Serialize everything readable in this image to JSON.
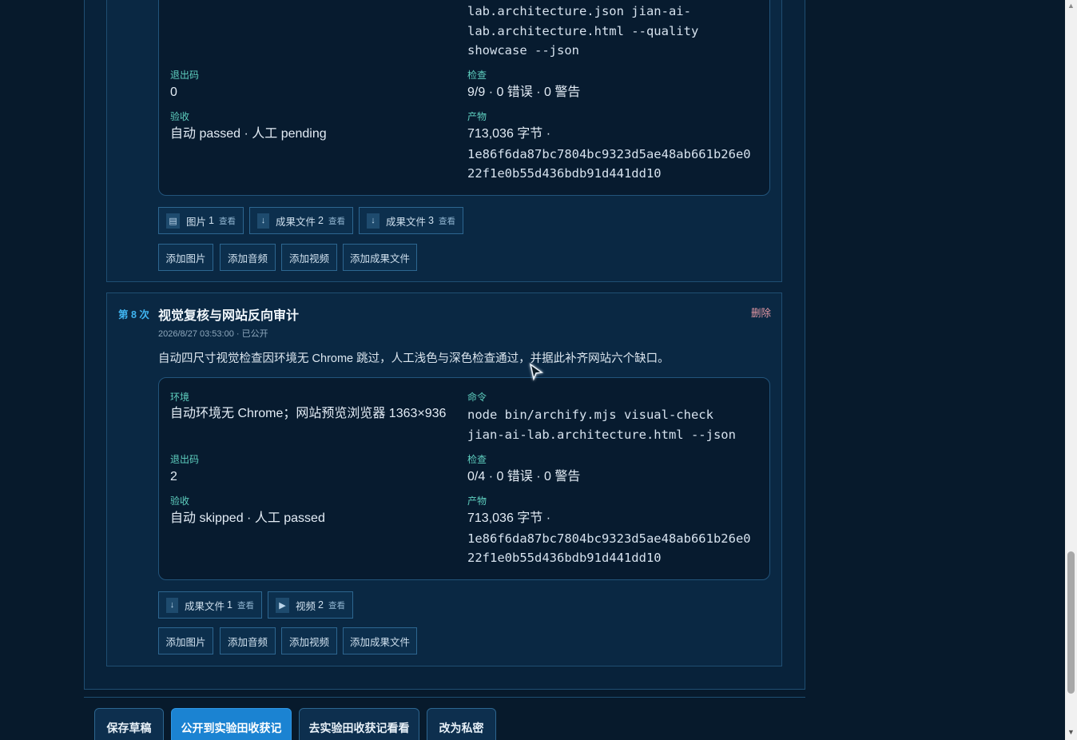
{
  "runs": [
    {
      "command_tail": [
        "lab.architecture.json jian-ai-",
        "lab.architecture.html --quality",
        "showcase --json"
      ],
      "fields": {
        "exit_label": "退出码",
        "exit_value": "0",
        "check_label": "检查",
        "check_value": "9/9 · 0 错误 · 0 警告",
        "acceptance_label": "验收",
        "acceptance_value": "自动 passed · 人工 pending",
        "artifact_label": "产物",
        "artifact_size": "713,036 字节 ·",
        "artifact_hash_1": "1e86f6da87bc7804bc9323d5ae48ab661b26e0",
        "artifact_hash_2": "22f1e0b55d436bdb91d441dd10"
      },
      "attachments": [
        {
          "icon": "image-icon",
          "glyph": "▤",
          "label": "图片",
          "count": "1",
          "view": "查看"
        },
        {
          "icon": "download-icon",
          "glyph": "↓",
          "label": "成果文件",
          "count": "2",
          "view": "查看"
        },
        {
          "icon": "download-icon",
          "glyph": "↓",
          "label": "成果文件",
          "count": "3",
          "view": "查看"
        }
      ],
      "add_buttons": [
        "添加图片",
        "添加音频",
        "添加视频",
        "添加成果文件"
      ]
    },
    {
      "number": "第 8 次",
      "title": "视觉复核与网站反向审计",
      "meta": "2026/8/27 03:53:00 · 已公开",
      "delete": "删除",
      "description": "自动四尺寸视觉检查因环境无 Chrome 跳过，人工浅色与深色检查通过，并据此补齐网站六个缺口。",
      "fields": {
        "env_label": "环境",
        "env_value": "自动环境无 Chrome；网站预览浏览器 1363×936",
        "cmd_label": "命令",
        "cmd_line_1": "node bin/archify.mjs visual-check",
        "cmd_line_2": "jian-ai-lab.architecture.html --json",
        "exit_label": "退出码",
        "exit_value": "2",
        "check_label": "检查",
        "check_value": "0/4 · 0 错误 · 0 警告",
        "acceptance_label": "验收",
        "acceptance_value": "自动 skipped · 人工 passed",
        "artifact_label": "产物",
        "artifact_size": "713,036 字节 ·",
        "artifact_hash_1": "1e86f6da87bc7804bc9323d5ae48ab661b26e0",
        "artifact_hash_2": "22f1e0b55d436bdb91d441dd10"
      },
      "attachments": [
        {
          "icon": "download-icon",
          "glyph": "↓",
          "label": "成果文件",
          "count": "1",
          "view": "查看"
        },
        {
          "icon": "play-icon",
          "glyph": "▶",
          "label": "视频",
          "count": "2",
          "view": "查看"
        }
      ],
      "add_buttons": [
        "添加图片",
        "添加音频",
        "添加视频",
        "添加成果文件"
      ]
    }
  ],
  "footer": {
    "save_draft": "保存草稿",
    "publish": "公开到实验田收获记",
    "go_view": "去实验田收获记看看",
    "make_private": "改为私密"
  },
  "colors": {
    "background": "#071a2c",
    "accent": "#1b83d2",
    "label": "#5fd0c0",
    "run_number": "#3fb4f0",
    "delete": "#e79aa6"
  }
}
